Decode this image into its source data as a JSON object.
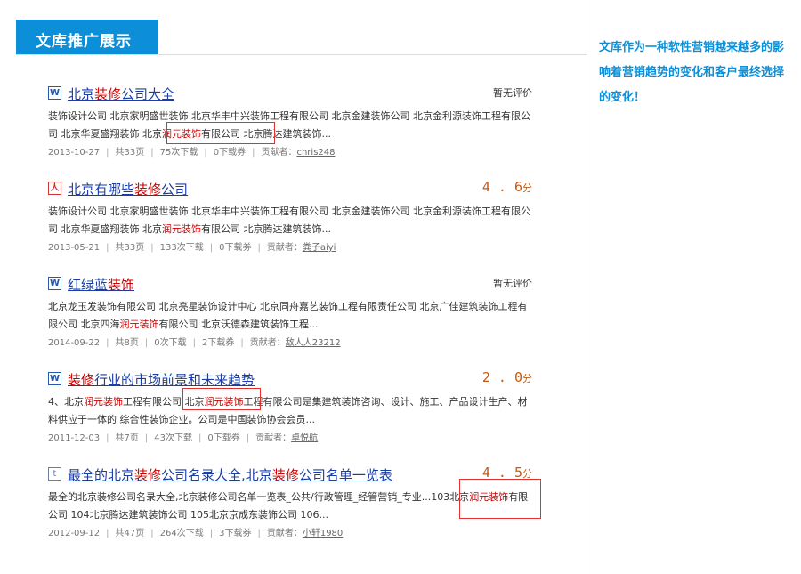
{
  "banner": {
    "title": "文库推广展示"
  },
  "side_note": {
    "text": "文库作为一种软性营销越来越多的影响着营销趋势的变化和客户最终选择的变化！"
  },
  "results": [
    {
      "icon": "word-doc-icon",
      "icon_glyph": "W",
      "title_parts": [
        [
          "北京",
          false
        ],
        [
          "装修",
          true
        ],
        [
          "公司大全",
          false
        ]
      ],
      "rating": "暂无评价",
      "rating_is_score": false,
      "snippet_parts": [
        [
          "装饰设计公司 北京家明盛世装饰 北京华丰中兴装饰工程有限公司 北京金建装饰公司 北京金利源装饰工程有限公司 北京华夏盛翔装饰 北京",
          false
        ],
        [
          "润元装饰",
          true
        ],
        [
          "有限公司 北京腾达建筑装饰...",
          false
        ]
      ],
      "date": "2013-10-27",
      "pages": "共33页",
      "downloads": "75次下载",
      "coupons": "0下载券",
      "contributor_label": "贡献者：",
      "contributor": "chris248"
    },
    {
      "icon": "pdf-doc-icon",
      "icon_glyph": "人",
      "title_parts": [
        [
          "北京有哪些",
          false
        ],
        [
          "装修",
          true
        ],
        [
          "公司",
          false
        ]
      ],
      "rating": "4.6",
      "rating_unit": "分",
      "rating_is_score": true,
      "snippet_parts": [
        [
          "装饰设计公司 北京家明盛世装饰 北京华丰中兴装饰工程有限公司 北京金建装饰公司 北京金利源装饰工程有限公司 北京华夏盛翔装饰 北京",
          false
        ],
        [
          "润元装饰",
          true
        ],
        [
          "有限公司 北京腾达建筑装饰...",
          false
        ]
      ],
      "date": "2013-05-21",
      "pages": "共33页",
      "downloads": "133次下载",
      "coupons": "0下载券",
      "contributor_label": "贡献者：",
      "contributor": "粪子aiyi"
    },
    {
      "icon": "word-doc-icon",
      "icon_glyph": "W",
      "title_parts": [
        [
          "红绿蓝",
          false
        ],
        [
          "装饰",
          true
        ]
      ],
      "rating": "暂无评价",
      "rating_is_score": false,
      "snippet_parts": [
        [
          "北京龙玉发装饰有限公司 北京亮星装饰设计中心 北京同舟嘉艺装饰工程有限责任公司 北京广佳建筑装饰工程有限公司 北京四海",
          false
        ],
        [
          "润元装饰",
          true
        ],
        [
          "有限公司 北京沃德森建筑装饰工程...",
          false
        ]
      ],
      "date": "2014-09-22",
      "pages": "共8页",
      "downloads": "0次下载",
      "coupons": "2下载券",
      "contributor_label": "贡献者：",
      "contributor": "敌人人23212"
    },
    {
      "icon": "word-doc-icon",
      "icon_glyph": "W",
      "title_parts": [
        [
          "装修",
          true
        ],
        [
          "行业的市场前景和未来趋势",
          false
        ]
      ],
      "rating": "2.0",
      "rating_unit": "分",
      "rating_is_score": true,
      "snippet_parts": [
        [
          "4、北京",
          false
        ],
        [
          "润元装饰",
          true
        ],
        [
          "工程有限公司 北京",
          false
        ],
        [
          "润元装饰",
          true
        ],
        [
          "工程有限公司是集建筑装饰咨询、设计、施工、产品设计生产、材料供应于一体的 综合性装饰企业。公司是中国装饰协会会员...",
          false
        ]
      ],
      "date": "2011-12-03",
      "pages": "共7页",
      "downloads": "43次下载",
      "coupons": "0下载券",
      "contributor_label": "贡献者：",
      "contributor": "卓悦航"
    },
    {
      "icon": "txt-doc-icon",
      "icon_glyph": "t",
      "title_parts": [
        [
          "最全的北京",
          false
        ],
        [
          "装修",
          true
        ],
        [
          "公司名录大全,北京",
          false
        ],
        [
          "装修",
          true
        ],
        [
          "公司名单一览表",
          false
        ]
      ],
      "rating": "4.5",
      "rating_unit": "分",
      "rating_is_score": true,
      "snippet_parts": [
        [
          "最全的北京装修公司名录大全,北京装修公司名单一览表_公共/行政管理_经管营销_专业...103北京",
          false
        ],
        [
          "润元装饰",
          true
        ],
        [
          "有限公司 104北京腾达建筑装饰公司 105北京京成东装饰公司 106...",
          false
        ]
      ],
      "date": "2012-09-12",
      "pages": "共47页",
      "downloads": "264次下载",
      "coupons": "3下载券",
      "contributor_label": "贡献者：",
      "contributor": "小轩1980"
    }
  ],
  "colors": {
    "accent": "#0c8fd8",
    "highlight": "#cc0000",
    "link": "#1a3da6",
    "score": "#c55a11",
    "annotation_box": "#e03030"
  }
}
